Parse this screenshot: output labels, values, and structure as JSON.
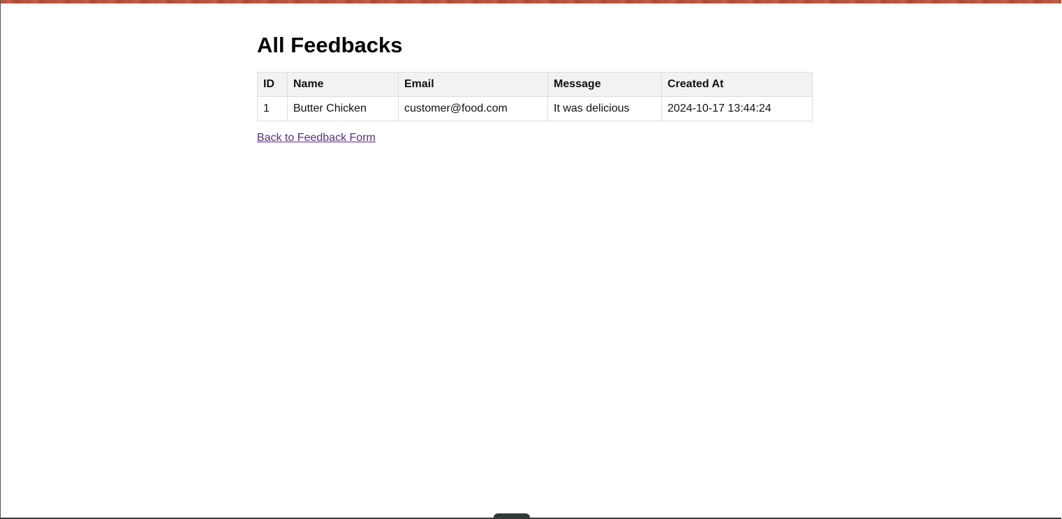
{
  "page": {
    "title": "All Feedbacks",
    "back_link": "Back to Feedback Form"
  },
  "table": {
    "headers": {
      "id": "ID",
      "name": "Name",
      "email": "Email",
      "message": "Message",
      "created_at": "Created At"
    },
    "rows": [
      {
        "id": "1",
        "name": "Butter Chicken",
        "email": "customer@food.com",
        "message": "It was delicious",
        "created_at": "2024-10-17 13:44:24"
      }
    ]
  },
  "colors": {
    "accent_strip": "#b0523c",
    "link": "#5b2a86",
    "header_bg": "#f2f2f2",
    "border": "#dddddd"
  }
}
